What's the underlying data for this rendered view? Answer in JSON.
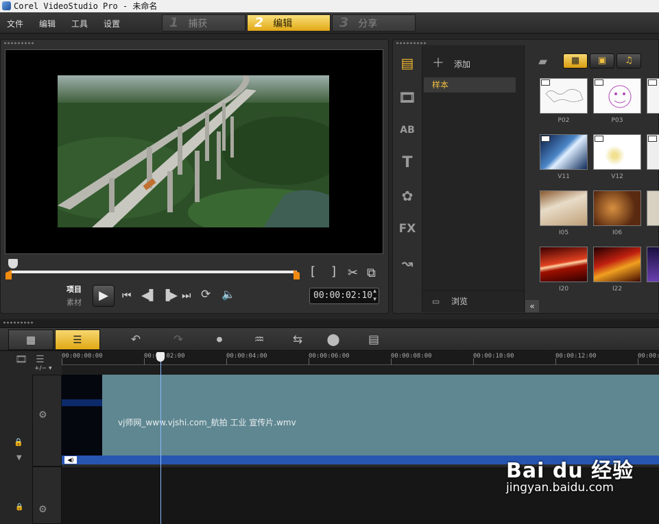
{
  "window": {
    "title": "Corel VideoStudio Pro - 未命名"
  },
  "menu": {
    "file": "文件",
    "edit": "编辑",
    "tools": "工具",
    "settings": "设置"
  },
  "steps": [
    {
      "num": "1",
      "label": "捕获"
    },
    {
      "num": "2",
      "label": "编辑"
    },
    {
      "num": "3",
      "label": "分享"
    }
  ],
  "preview": {
    "mode_project": "项目",
    "mode_clip": "素材",
    "mark_in": "[",
    "mark_out": "]",
    "timecode": "00:00:02:10"
  },
  "library": {
    "add_label": "添加",
    "folder": "样本",
    "browse_label": "浏览",
    "collapse": "«",
    "side_icons": [
      "media-icon",
      "instant-project-icon",
      "transition-icon",
      "title-icon",
      "graphic-icon",
      "filter-icon",
      "path-icon"
    ],
    "side_text": {
      "transition": "AB",
      "title": "T",
      "filter": "FX"
    },
    "thumbs": [
      {
        "label": "P02"
      },
      {
        "label": "P03"
      },
      {
        "label": "V11"
      },
      {
        "label": "V12"
      },
      {
        "label": "I05"
      },
      {
        "label": "I06"
      },
      {
        "label": "I20"
      },
      {
        "label": "I22"
      }
    ]
  },
  "timeline": {
    "ruler": [
      "00:00:00:00",
      "00:00:02:00",
      "00:00:04:00",
      "00:00:06:00",
      "00:00:08:00",
      "00:00:10:00",
      "00:00:12:00",
      "00:00:1"
    ],
    "zoom_label": "+/−",
    "clip_name": "vj师网_www.vjshi.com_航拍 工业 宣传片.wmv"
  },
  "watermark": {
    "brand": "Bai du 经验",
    "site": "jingyan.baidu.com"
  },
  "colors": {
    "accent": "#e8b320",
    "clip": "#5f8791",
    "audio": "#2756b0",
    "marker": "#f08a10"
  }
}
